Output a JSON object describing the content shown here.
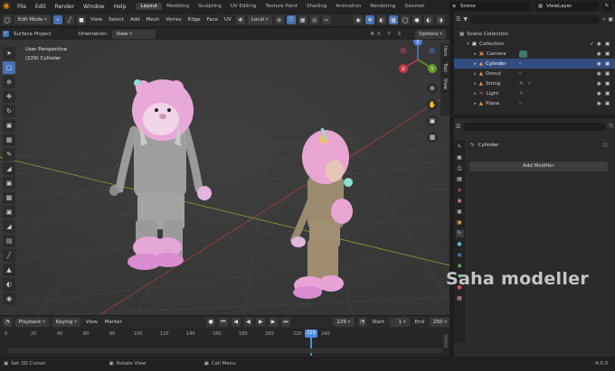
{
  "menu": {
    "items": [
      "File",
      "Edit",
      "Render",
      "Window",
      "Help"
    ],
    "workspaces": [
      "Layout",
      "Modeling",
      "Sculpting",
      "UV Editing",
      "Texture Paint",
      "Shading",
      "Animation",
      "Rendering",
      "Geomet"
    ],
    "active_workspace": "Layout",
    "scene": "Scene",
    "view_layer": "ViewLayer"
  },
  "header": {
    "mode": "Edit Mode",
    "menus": [
      "View",
      "Select",
      "Add",
      "Mesh",
      "Vertex",
      "Edge",
      "Face",
      "UV"
    ],
    "transform": "Local",
    "options": "Options"
  },
  "header2": {
    "surface_project": "Surface Project",
    "orientation_label": "Orientation:",
    "orientation_value": "View"
  },
  "viewport": {
    "perspective": "User Perspective",
    "object": "(229) Cylinder",
    "side_tabs": [
      "Item",
      "Tool",
      "View"
    ],
    "gizmo": {
      "x": "X",
      "y": "Y",
      "z": "Z"
    }
  },
  "outliner": {
    "root": "Scene Collection",
    "collection": "Collection",
    "items": [
      {
        "name": "Camera",
        "icon": "camera-icon",
        "color": "#7fb0a0"
      },
      {
        "name": "Cylinder",
        "icon": "mesh-icon",
        "color": "#7fb0a0"
      },
      {
        "name": "Donut",
        "icon": "mesh-icon",
        "color": "#7fb0a0"
      },
      {
        "name": "String",
        "icon": "mesh-icon",
        "color": "#7fb0a0"
      },
      {
        "name": "Light",
        "icon": "light-icon",
        "color": "#7fb0a0"
      },
      {
        "name": "Plane",
        "icon": "mesh-icon",
        "color": "#7fb0a0"
      }
    ],
    "selected": "Cylinder"
  },
  "properties": {
    "object_name": "Cylinder",
    "add_modifier": "Add Modifier"
  },
  "timeline": {
    "menus": [
      "Playback",
      "Keying",
      "View",
      "Marker"
    ],
    "current_frame": "229",
    "start_label": "Start",
    "start": "1",
    "end_label": "End",
    "end": "250",
    "ticks": [
      "0",
      "20",
      "40",
      "60",
      "80",
      "100",
      "120",
      "140",
      "160",
      "180",
      "200",
      "220",
      "229",
      "240"
    ]
  },
  "status": {
    "left": "Set 3D Cursor",
    "middle": "Rotate View",
    "right": "Call Menu",
    "version": "4.0.0"
  },
  "watermark": "Saha modeller",
  "colors": {
    "accent": "#4772b3",
    "selection": "#334d80",
    "frame": "#4a8fe0"
  }
}
